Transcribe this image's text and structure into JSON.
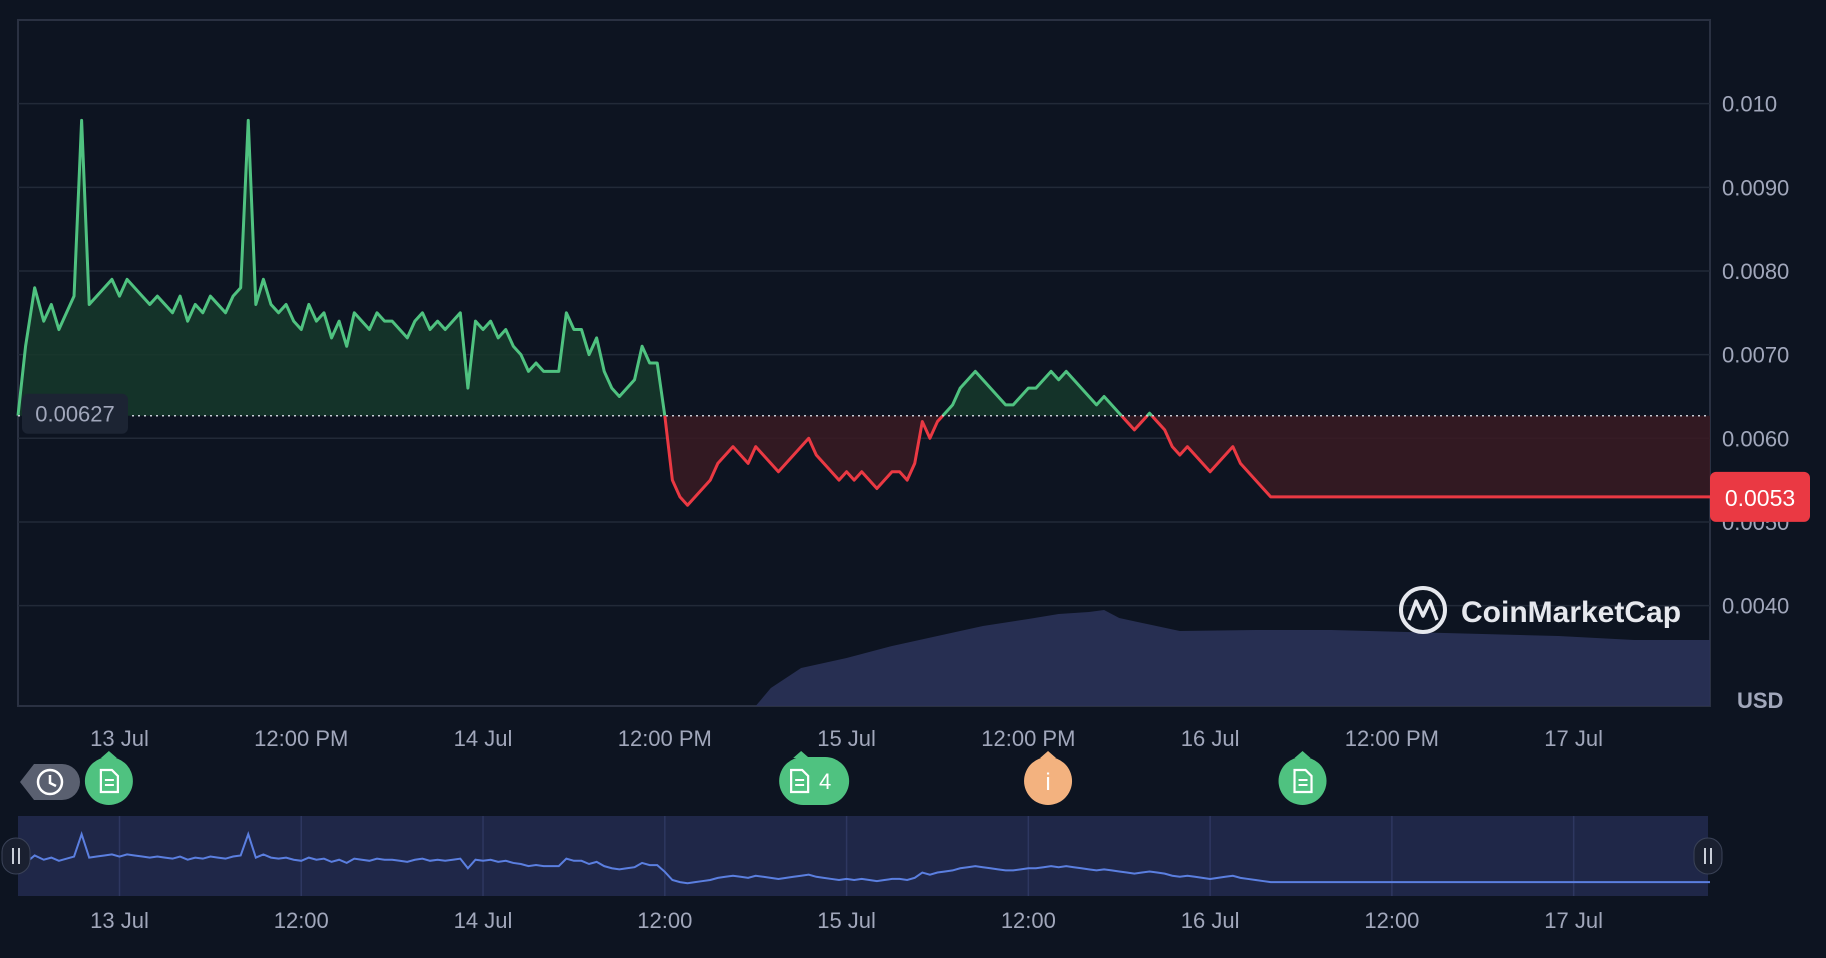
{
  "chart_data": {
    "type": "area",
    "baseline_value": 0.00627,
    "baseline_label": "0.00627",
    "current_price_label": "0.0053",
    "y_unit_label": "USD",
    "ylim": [
      0.0028,
      0.011
    ],
    "y_ticks": [
      {
        "value": 0.01,
        "label": "0.010"
      },
      {
        "value": 0.009,
        "label": "0.0090"
      },
      {
        "value": 0.008,
        "label": "0.0080"
      },
      {
        "value": 0.007,
        "label": "0.0070"
      },
      {
        "value": 0.006,
        "label": "0.0060"
      },
      {
        "value": 0.005,
        "label": "0.0050"
      },
      {
        "value": 0.004,
        "label": "0.0040"
      }
    ],
    "x_domain_hours": [
      -6.7,
      105.0
    ],
    "x_ticks_main": [
      {
        "t": 0,
        "label": "13 Jul"
      },
      {
        "t": 12,
        "label": "12:00 PM"
      },
      {
        "t": 24,
        "label": "14 Jul"
      },
      {
        "t": 36,
        "label": "12:00 PM"
      },
      {
        "t": 48,
        "label": "15 Jul"
      },
      {
        "t": 60,
        "label": "12:00 PM"
      },
      {
        "t": 72,
        "label": "16 Jul"
      },
      {
        "t": 84,
        "label": "12:00 PM"
      },
      {
        "t": 96,
        "label": "17 Jul"
      }
    ],
    "x_ticks_nav": [
      {
        "t": 0,
        "label": "13 Jul"
      },
      {
        "t": 12,
        "label": "12:00"
      },
      {
        "t": 24,
        "label": "14 Jul"
      },
      {
        "t": 36,
        "label": "12:00"
      },
      {
        "t": 48,
        "label": "15 Jul"
      },
      {
        "t": 60,
        "label": "12:00"
      },
      {
        "t": 72,
        "label": "16 Jul"
      },
      {
        "t": 84,
        "label": "12:00"
      },
      {
        "t": 96,
        "label": "17 Jul"
      }
    ],
    "price_series": {
      "x_hours": [
        -6.7,
        -6.2,
        -5.6,
        -5.0,
        -4.5,
        -4.0,
        -3.5,
        -3.0,
        -2.5,
        -2.0,
        -1.5,
        -1.0,
        -0.5,
        0.0,
        0.5,
        1.0,
        1.5,
        2.0,
        2.5,
        3.0,
        3.5,
        4.0,
        4.5,
        5.0,
        5.5,
        6.0,
        6.5,
        7.0,
        7.5,
        8.0,
        8.5,
        9.0,
        9.5,
        10.0,
        10.5,
        11.0,
        11.5,
        12.0,
        12.5,
        13.0,
        13.5,
        14.0,
        14.5,
        15.0,
        15.5,
        16.0,
        16.5,
        17.0,
        17.5,
        18.0,
        18.5,
        19.0,
        19.5,
        20.0,
        20.5,
        21.0,
        21.5,
        22.0,
        22.5,
        23.0,
        23.5,
        24.0,
        24.5,
        25.0,
        25.5,
        26.0,
        26.5,
        27.0,
        27.5,
        28.0,
        28.5,
        29.0,
        29.5,
        30.0,
        30.5,
        31.0,
        31.5,
        32.0,
        32.5,
        33.0,
        33.5,
        34.0,
        34.5,
        35.0,
        35.5,
        36.0,
        36.5,
        37.0,
        37.5,
        38.0,
        38.5,
        39.0,
        39.5,
        40.0,
        40.5,
        41.0,
        41.5,
        42.0,
        42.5,
        43.0,
        43.5,
        44.0,
        44.5,
        45.0,
        45.5,
        46.0,
        46.5,
        47.0,
        47.5,
        48.0,
        48.5,
        49.0,
        49.5,
        50.0,
        50.5,
        51.0,
        51.5,
        52.0,
        52.5,
        53.0,
        53.5,
        54.0,
        54.5,
        55.0,
        55.5,
        56.0,
        56.5,
        57.0,
        57.5,
        58.0,
        58.5,
        59.0,
        59.5,
        60.0,
        60.5,
        61.0,
        61.5,
        62.0,
        62.5,
        63.0,
        63.5,
        64.0,
        64.5,
        65.0,
        65.5,
        66.0,
        66.5,
        67.0,
        67.5,
        68.0,
        68.5,
        69.0,
        69.5,
        70.0,
        70.5,
        71.0,
        71.5,
        72.0,
        72.5,
        73.0,
        73.5,
        74.0,
        74.5,
        75.0,
        75.5,
        76.0,
        76.5,
        77.0,
        77.5,
        78.0,
        78.5,
        79.0,
        79.5,
        80.0,
        80.5,
        81.0,
        81.5,
        82.0,
        82.5,
        83.0,
        83.5,
        84.0,
        84.5,
        85.0,
        85.5,
        86.0,
        86.5,
        87.0,
        87.5,
        88.0,
        88.5,
        89.0,
        89.5,
        90.0,
        90.5,
        91.0,
        91.5,
        92.0,
        92.5,
        93.0,
        93.5,
        94.0,
        94.5,
        95.0,
        95.5,
        96.0,
        96.5,
        97.0,
        97.5,
        98.0,
        98.5,
        99.0,
        99.5,
        100.0,
        100.5,
        101.0,
        101.5,
        102.0,
        102.5,
        103.0,
        103.5,
        104.0,
        104.5,
        105.0
      ],
      "values": [
        0.00627,
        0.0071,
        0.0078,
        0.0074,
        0.0076,
        0.0073,
        0.0075,
        0.0077,
        0.0098,
        0.0076,
        0.0077,
        0.0078,
        0.0079,
        0.0077,
        0.0079,
        0.0078,
        0.0077,
        0.0076,
        0.0077,
        0.0076,
        0.0075,
        0.0077,
        0.0074,
        0.0076,
        0.0075,
        0.0077,
        0.0076,
        0.0075,
        0.0077,
        0.0078,
        0.0098,
        0.0076,
        0.0079,
        0.0076,
        0.0075,
        0.0076,
        0.0074,
        0.0073,
        0.0076,
        0.0074,
        0.0075,
        0.0072,
        0.0074,
        0.0071,
        0.0075,
        0.0074,
        0.0073,
        0.0075,
        0.0074,
        0.0074,
        0.0073,
        0.0072,
        0.0074,
        0.0075,
        0.0073,
        0.0074,
        0.0073,
        0.0074,
        0.0075,
        0.0066,
        0.0074,
        0.0073,
        0.0074,
        0.0072,
        0.0073,
        0.0071,
        0.007,
        0.0068,
        0.0069,
        0.0068,
        0.0068,
        0.0068,
        0.0075,
        0.0073,
        0.0073,
        0.007,
        0.0072,
        0.0068,
        0.0066,
        0.0065,
        0.0066,
        0.0067,
        0.0071,
        0.0069,
        0.0069,
        0.00627,
        0.0055,
        0.0053,
        0.0052,
        0.0053,
        0.0054,
        0.0055,
        0.0057,
        0.0058,
        0.0059,
        0.0058,
        0.0057,
        0.0059,
        0.0058,
        0.0057,
        0.0056,
        0.0057,
        0.0058,
        0.0059,
        0.006,
        0.0058,
        0.0057,
        0.0056,
        0.0055,
        0.0056,
        0.0055,
        0.0056,
        0.0055,
        0.0054,
        0.0055,
        0.0056,
        0.0056,
        0.0055,
        0.0057,
        0.0062,
        0.006,
        0.0062,
        0.0063,
        0.0064,
        0.0066,
        0.0067,
        0.0068,
        0.0067,
        0.0066,
        0.0065,
        0.0064,
        0.0064,
        0.0065,
        0.0066,
        0.0066,
        0.0067,
        0.0068,
        0.0067,
        0.0068,
        0.0067,
        0.0066,
        0.0065,
        0.0064,
        0.0065,
        0.0064,
        0.0063,
        0.0062,
        0.0061,
        0.0062,
        0.0063,
        0.0062,
        0.0061,
        0.0059,
        0.0058,
        0.0059,
        0.0058,
        0.0057,
        0.0056,
        0.0057,
        0.0058,
        0.0059,
        0.0057,
        0.0056,
        0.0055,
        0.0054,
        0.0053,
        0.0053,
        0.0053,
        0.0053,
        0.0053,
        0.0053,
        0.0053,
        0.0053,
        0.0053,
        0.0053,
        0.0053,
        0.0053,
        0.0053,
        0.0053,
        0.0053,
        0.0053,
        0.0053,
        0.0053,
        0.0053,
        0.0053,
        0.0053,
        0.0053,
        0.0053,
        0.0053,
        0.0053,
        0.0053,
        0.0053,
        0.0053,
        0.0053,
        0.0053,
        0.0053,
        0.0053,
        0.0053,
        0.0053,
        0.0053,
        0.0053,
        0.0053,
        0.0053,
        0.0053,
        0.0053,
        0.0053,
        0.0053,
        0.0053,
        0.0053,
        0.0053,
        0.0053,
        0.0053,
        0.0053,
        0.0053,
        0.0053,
        0.0053,
        0.0053,
        0.0053,
        0.0053,
        0.0053,
        0.0053,
        0.0053,
        0.0053,
        0.0053,
        0.0053,
        0.0053,
        0.0053,
        0.0053,
        0.0053,
        0.0053,
        0.0053,
        0.0053,
        0.0053,
        0.0053,
        0.0053
      ]
    },
    "volume_series": {
      "x_hours": [
        42.0,
        43.0,
        45.0,
        48.0,
        51.0,
        54.0,
        57.0,
        60.0,
        62.0,
        64.0,
        65.0,
        66.0,
        70.0,
        75.0,
        80.0,
        85.0,
        90.0,
        95.0,
        100.0,
        105.0
      ],
      "relative": [
        0.0,
        0.18,
        0.38,
        0.48,
        0.6,
        0.7,
        0.8,
        0.87,
        0.92,
        0.94,
        0.96,
        0.88,
        0.75,
        0.76,
        0.76,
        0.74,
        0.72,
        0.7,
        0.66,
        0.66
      ]
    },
    "events": [
      {
        "t": -0.7,
        "kind": "document",
        "label": ""
      },
      {
        "t": 45.0,
        "kind": "document",
        "label": "4"
      },
      {
        "t": 61.3,
        "kind": "info",
        "label": "i"
      },
      {
        "t": 78.1,
        "kind": "document",
        "label": ""
      }
    ],
    "watermark": "CoinMarketCap",
    "colors": {
      "background": "#0d1421",
      "grid": "#222a38",
      "up": "#4fc280",
      "down": "#ea3943",
      "up_fill": "#16382a",
      "down_fill": "#3a1a22",
      "volume": "#2a3258",
      "nav_line": "#5b7fe0",
      "nav_fill": "#1f2748",
      "info_marker": "#f3b27f"
    }
  }
}
